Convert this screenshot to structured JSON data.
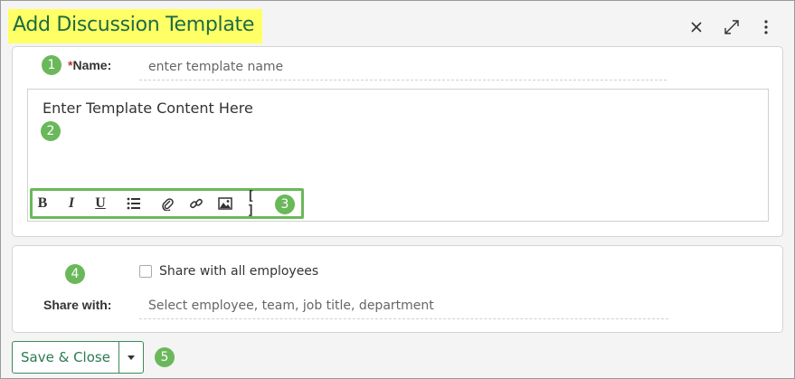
{
  "dialog": {
    "title": "Add Discussion Template"
  },
  "badges": [
    "1",
    "2",
    "3",
    "4",
    "5"
  ],
  "name_field": {
    "required_mark": "*",
    "label": "Name:",
    "placeholder": "enter template name"
  },
  "editor": {
    "placeholder": "Enter Template Content Here",
    "toolbar": {
      "bold": "B",
      "italic": "I",
      "underline": "U",
      "brackets": "[ ]"
    }
  },
  "sharing": {
    "checkbox_label": "Share with all employees",
    "checked": false,
    "label": "Share with:",
    "placeholder": "Select employee, team, job title, department"
  },
  "footer": {
    "save_label": "Save & Close"
  },
  "colors": {
    "title": "#1d6b45",
    "title_highlight": "#ffff66",
    "badge": "#6ab85a",
    "button_border": "#3b8a5c"
  }
}
